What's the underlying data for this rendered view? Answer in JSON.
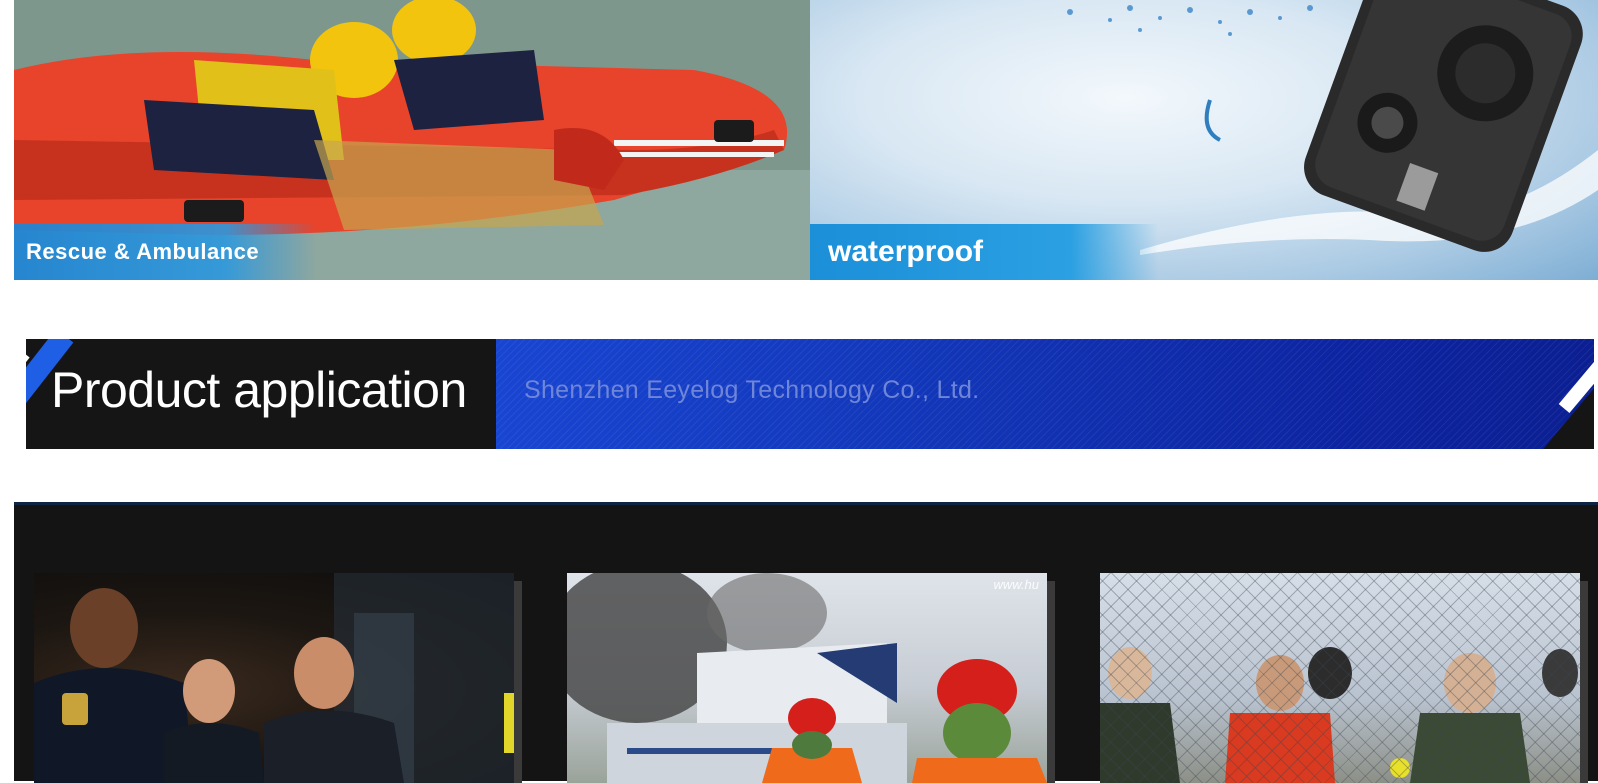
{
  "banners": {
    "left": {
      "caption": "Rescue & Ambulance",
      "scene": "rescue-boat-image"
    },
    "right": {
      "caption": "waterproof",
      "scene": "waterproof-camera-image"
    }
  },
  "section": {
    "title": "Product application",
    "subtitle": "Shenzhen Eeyelog Technology Co., Ltd."
  },
  "gallery": {
    "items": [
      {
        "scene": "police-officers-image"
      },
      {
        "scene": "firefighters-aircraft-image",
        "watermark": "www.hu"
      },
      {
        "scene": "fence-security-image"
      }
    ]
  },
  "colors": {
    "accent_blue": "#1f5fe6",
    "bar_dark": "#151515",
    "caption_blue": "#2ba0e2",
    "subtitle_text": "#6f86d8"
  }
}
